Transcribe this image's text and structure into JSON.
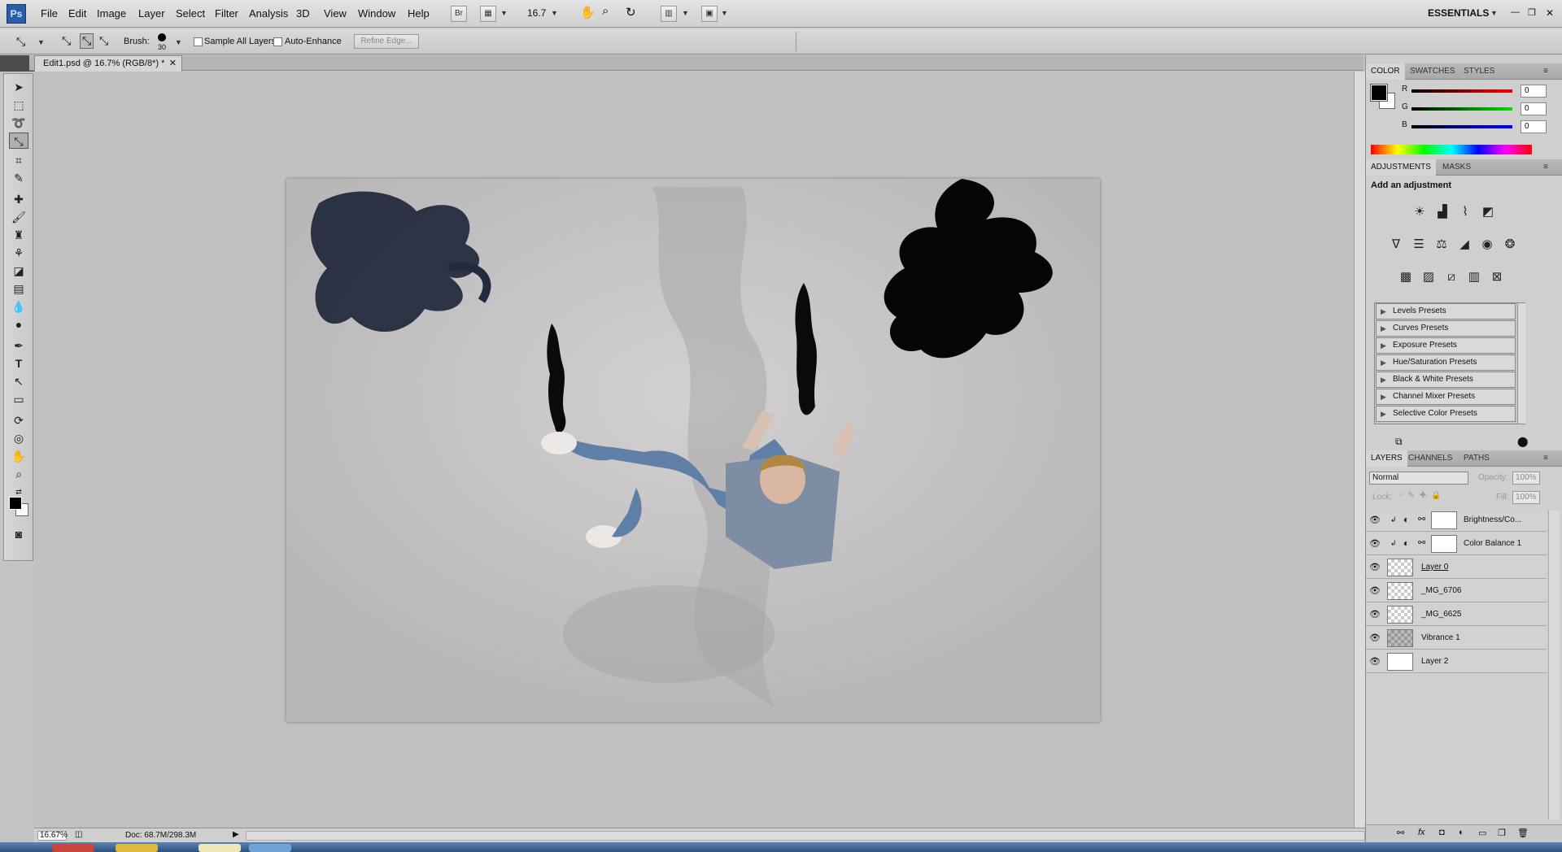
{
  "app": {
    "logo": "Ps",
    "workspace": "ESSENTIALS"
  },
  "menu": [
    "File",
    "Edit",
    "Image",
    "Layer",
    "Select",
    "Filter",
    "Analysis",
    "3D",
    "View",
    "Window",
    "Help"
  ],
  "menubar": {
    "bridge_label": "Br",
    "zoom": "16.7"
  },
  "options": {
    "brush_label": "Brush:",
    "brush_size": "30",
    "sample_all_layers": "Sample All Layers",
    "auto_enhance": "Auto-Enhance",
    "refine_edge": "Refine Edge..."
  },
  "document": {
    "tab_title": "Edit1.psd @ 16.7% (RGB/8*) *"
  },
  "status": {
    "zoom": "16.67%",
    "doc_size": "Doc: 68.7M/298.3M"
  },
  "color_panel": {
    "tabs": [
      "COLOR",
      "SWATCHES",
      "STYLES"
    ],
    "r_label": "R",
    "g_label": "G",
    "b_label": "B",
    "r": "0",
    "g": "0",
    "b": "0"
  },
  "adjustments_panel": {
    "tabs": [
      "ADJUSTMENTS",
      "MASKS"
    ],
    "heading": "Add an adjustment",
    "presets": [
      "Levels Presets",
      "Curves Presets",
      "Exposure Presets",
      "Hue/Saturation Presets",
      "Black & White Presets",
      "Channel Mixer Presets",
      "Selective Color Presets"
    ]
  },
  "layers_panel": {
    "tabs": [
      "LAYERS",
      "CHANNELS",
      "PATHS"
    ],
    "blend_mode": "Normal",
    "opacity_label": "Opacity:",
    "opacity": "100%",
    "lock_label": "Lock:",
    "fill_label": "Fill:",
    "fill": "100%",
    "layers": [
      {
        "name": "Brightness/Co...",
        "thumb": "white"
      },
      {
        "name": "Color Balance 1",
        "thumb": "white"
      },
      {
        "name": "Layer 0",
        "thumb": "checker"
      },
      {
        "name": "_MG_6706",
        "thumb": "checker"
      },
      {
        "name": "_MG_6625",
        "thumb": "checker"
      },
      {
        "name": "Vibrance 1",
        "thumb": "gray"
      },
      {
        "name": "Layer 2",
        "thumb": "white"
      }
    ]
  },
  "colors": {
    "foreground": "#000000",
    "background": "#ffffff",
    "canvas_bg": "#c1c1c1",
    "photo_bg": "#c8c6c6"
  }
}
